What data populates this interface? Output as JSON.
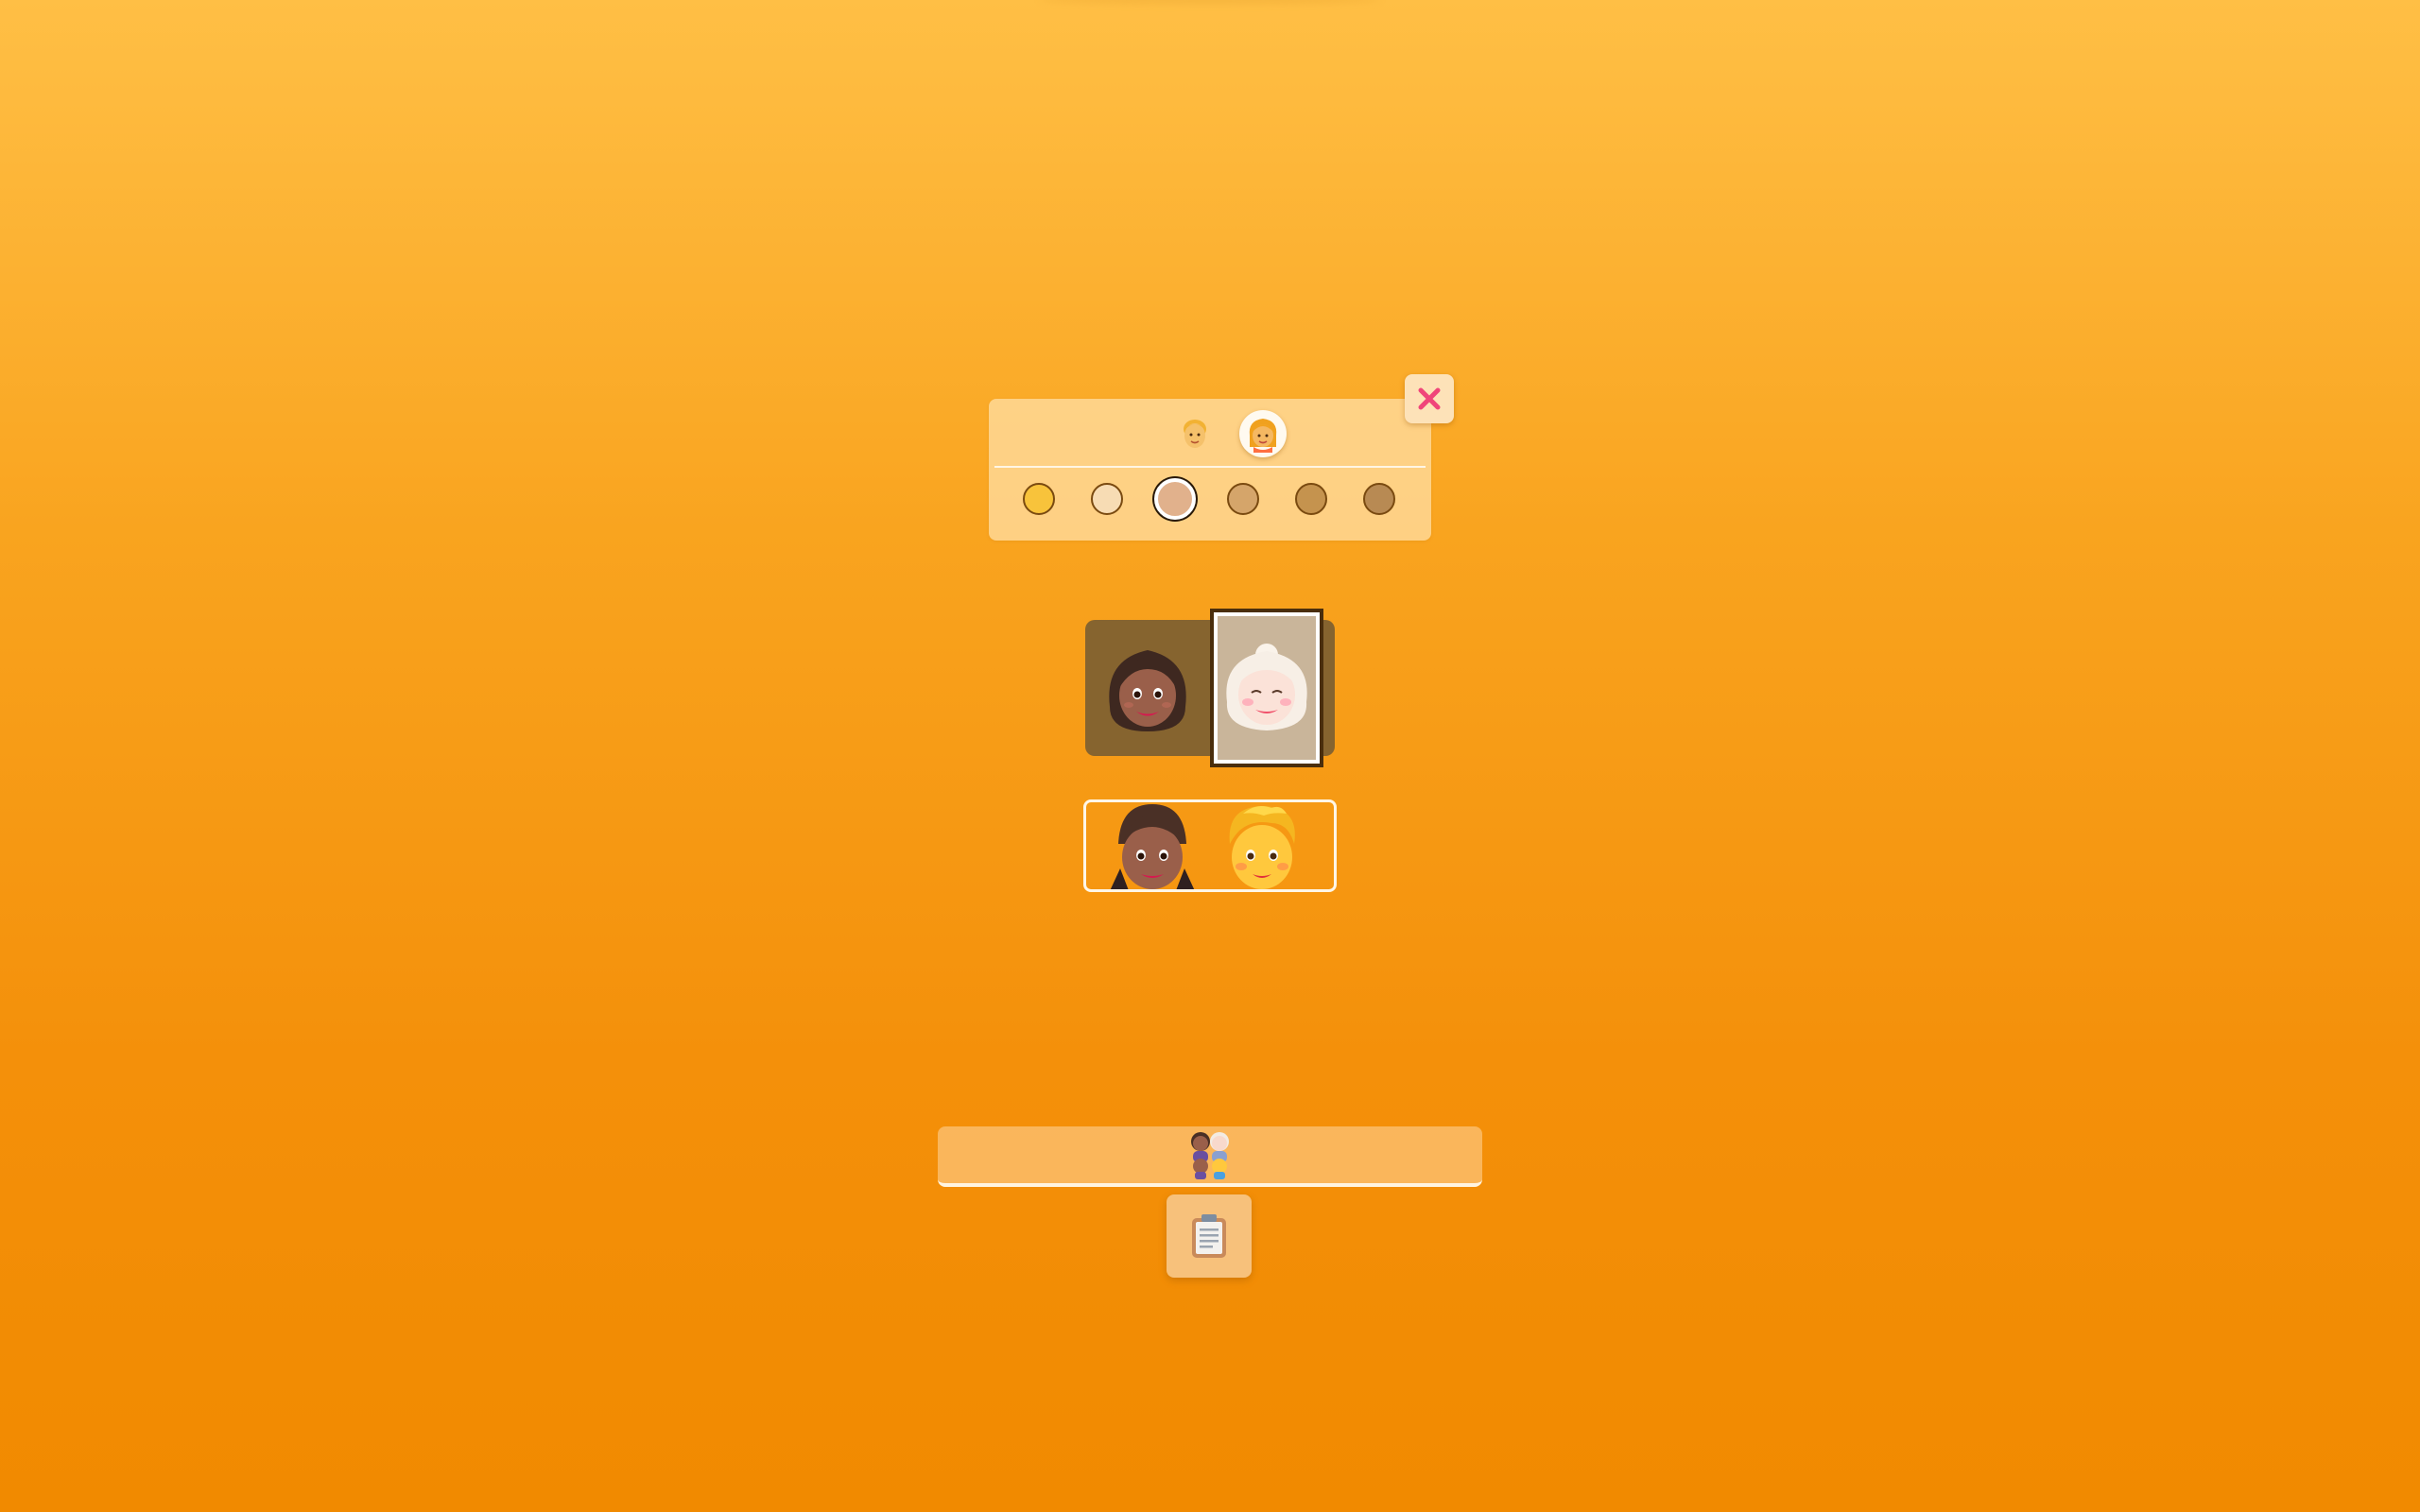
{
  "picker": {
    "variants": [
      {
        "icon": "person-blond-icon",
        "selected": false
      },
      {
        "icon": "woman-blond-icon",
        "selected": true
      }
    ],
    "skin_tones": [
      {
        "name": "default",
        "color": "#f8c33b",
        "selected": false
      },
      {
        "name": "light",
        "color": "#f7dcb4",
        "selected": false
      },
      {
        "name": "medium-light",
        "color": "#e1b18c",
        "selected": true
      },
      {
        "name": "medium",
        "color": "#d5a56a",
        "selected": false
      },
      {
        "name": "medium-dark",
        "color": "#c5934e",
        "selected": false
      },
      {
        "name": "dark",
        "color": "#b88a53",
        "selected": false
      }
    ]
  },
  "close_button": {
    "icon": "close-icon",
    "color": "#f0457a"
  },
  "selection": {
    "tiles": [
      {
        "icon": "woman-medium-dark-icon",
        "selected": false
      },
      {
        "icon": "woman-white-hair-light-icon",
        "selected": true
      }
    ],
    "preview": [
      {
        "icon": "girl-medium-dark-icon"
      },
      {
        "icon": "boy-default-icon"
      }
    ]
  },
  "result": {
    "icon": "family-combined-icon"
  },
  "copy_button": {
    "icon": "clipboard-icon"
  },
  "colors": {
    "background_top": "#ffbf45",
    "background_bottom": "#f18a00",
    "tile_background": "#86642f"
  }
}
